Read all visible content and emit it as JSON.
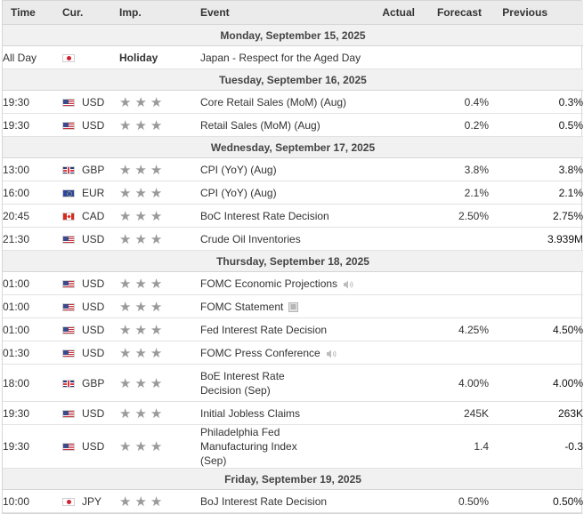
{
  "columns": {
    "time": "Time",
    "currency": "Cur.",
    "importance": "Imp.",
    "event": "Event",
    "actual": "Actual",
    "forecast": "Forecast",
    "previous": "Previous"
  },
  "stars_glyph": "★★★",
  "days": [
    {
      "label": "Monday, September 15, 2025",
      "events": [
        {
          "time": "All Day",
          "flag": "jp",
          "currency": "",
          "importance": "Holiday",
          "event": "Japan - Respect for the Aged Day",
          "actual": "",
          "forecast": "",
          "previous": ""
        }
      ]
    },
    {
      "label": "Tuesday, September 16, 2025",
      "events": [
        {
          "time": "19:30",
          "flag": "us",
          "currency": "USD",
          "event": "Core Retail Sales (MoM) (Aug)",
          "actual": "",
          "forecast": "0.4%",
          "previous": "0.3%"
        },
        {
          "time": "19:30",
          "flag": "us",
          "currency": "USD",
          "event": "Retail Sales (MoM) (Aug)",
          "actual": "",
          "forecast": "0.2%",
          "previous": "0.5%"
        }
      ]
    },
    {
      "label": "Wednesday, September 17, 2025",
      "events": [
        {
          "time": "13:00",
          "flag": "gb",
          "currency": "GBP",
          "event": "CPI (YoY) (Aug)",
          "actual": "",
          "forecast": "3.8%",
          "previous": "3.8%"
        },
        {
          "time": "16:00",
          "flag": "eu",
          "currency": "EUR",
          "event": "CPI (YoY) (Aug)",
          "actual": "",
          "forecast": "2.1%",
          "previous": "2.1%"
        },
        {
          "time": "20:45",
          "flag": "ca",
          "currency": "CAD",
          "event": "BoC Interest Rate Decision",
          "actual": "",
          "forecast": "2.50%",
          "previous": "2.75%"
        },
        {
          "time": "21:30",
          "flag": "us",
          "currency": "USD",
          "event": "Crude Oil Inventories",
          "actual": "",
          "forecast": "",
          "previous": "3.939M"
        }
      ]
    },
    {
      "label": "Thursday, September 18, 2025",
      "events": [
        {
          "time": "01:00",
          "flag": "us",
          "currency": "USD",
          "event": "FOMC Economic Projections",
          "icon": "speaker-icon",
          "actual": "",
          "forecast": "",
          "previous": ""
        },
        {
          "time": "01:00",
          "flag": "us",
          "currency": "USD",
          "event": "FOMC Statement",
          "icon": "document-icon",
          "actual": "",
          "forecast": "",
          "previous": ""
        },
        {
          "time": "01:00",
          "flag": "us",
          "currency": "USD",
          "event": "Fed Interest Rate Decision",
          "actual": "",
          "forecast": "4.25%",
          "previous": "4.50%"
        },
        {
          "time": "01:30",
          "flag": "us",
          "currency": "USD",
          "event": "FOMC Press Conference",
          "icon": "speaker-icon",
          "actual": "",
          "forecast": "",
          "previous": ""
        },
        {
          "time": "18:00",
          "flag": "gb",
          "currency": "GBP",
          "event": "BoE Interest Rate Decision (Sep)",
          "actual": "",
          "forecast": "4.00%",
          "previous": "4.00%",
          "tall": true
        },
        {
          "time": "19:30",
          "flag": "us",
          "currency": "USD",
          "event": "Initial Jobless Claims",
          "actual": "",
          "forecast": "245K",
          "previous": "263K"
        },
        {
          "time": "19:30",
          "flag": "us",
          "currency": "USD",
          "event": "Philadelphia Fed Manufacturing Index (Sep)",
          "actual": "",
          "forecast": "1.4",
          "previous": "-0.3",
          "tall": true
        }
      ]
    },
    {
      "label": "Friday, September 19, 2025",
      "events": [
        {
          "time": "10:00",
          "flag": "jp",
          "currency": "JPY",
          "event": "BoJ Interest Rate Decision",
          "actual": "",
          "forecast": "0.50%",
          "previous": "0.50%"
        }
      ]
    }
  ],
  "colors": {
    "header_bg": "#ebebeb",
    "day_bg": "#f1f1f1",
    "star": "#9a9a9a",
    "border": "#d6d6d6"
  }
}
